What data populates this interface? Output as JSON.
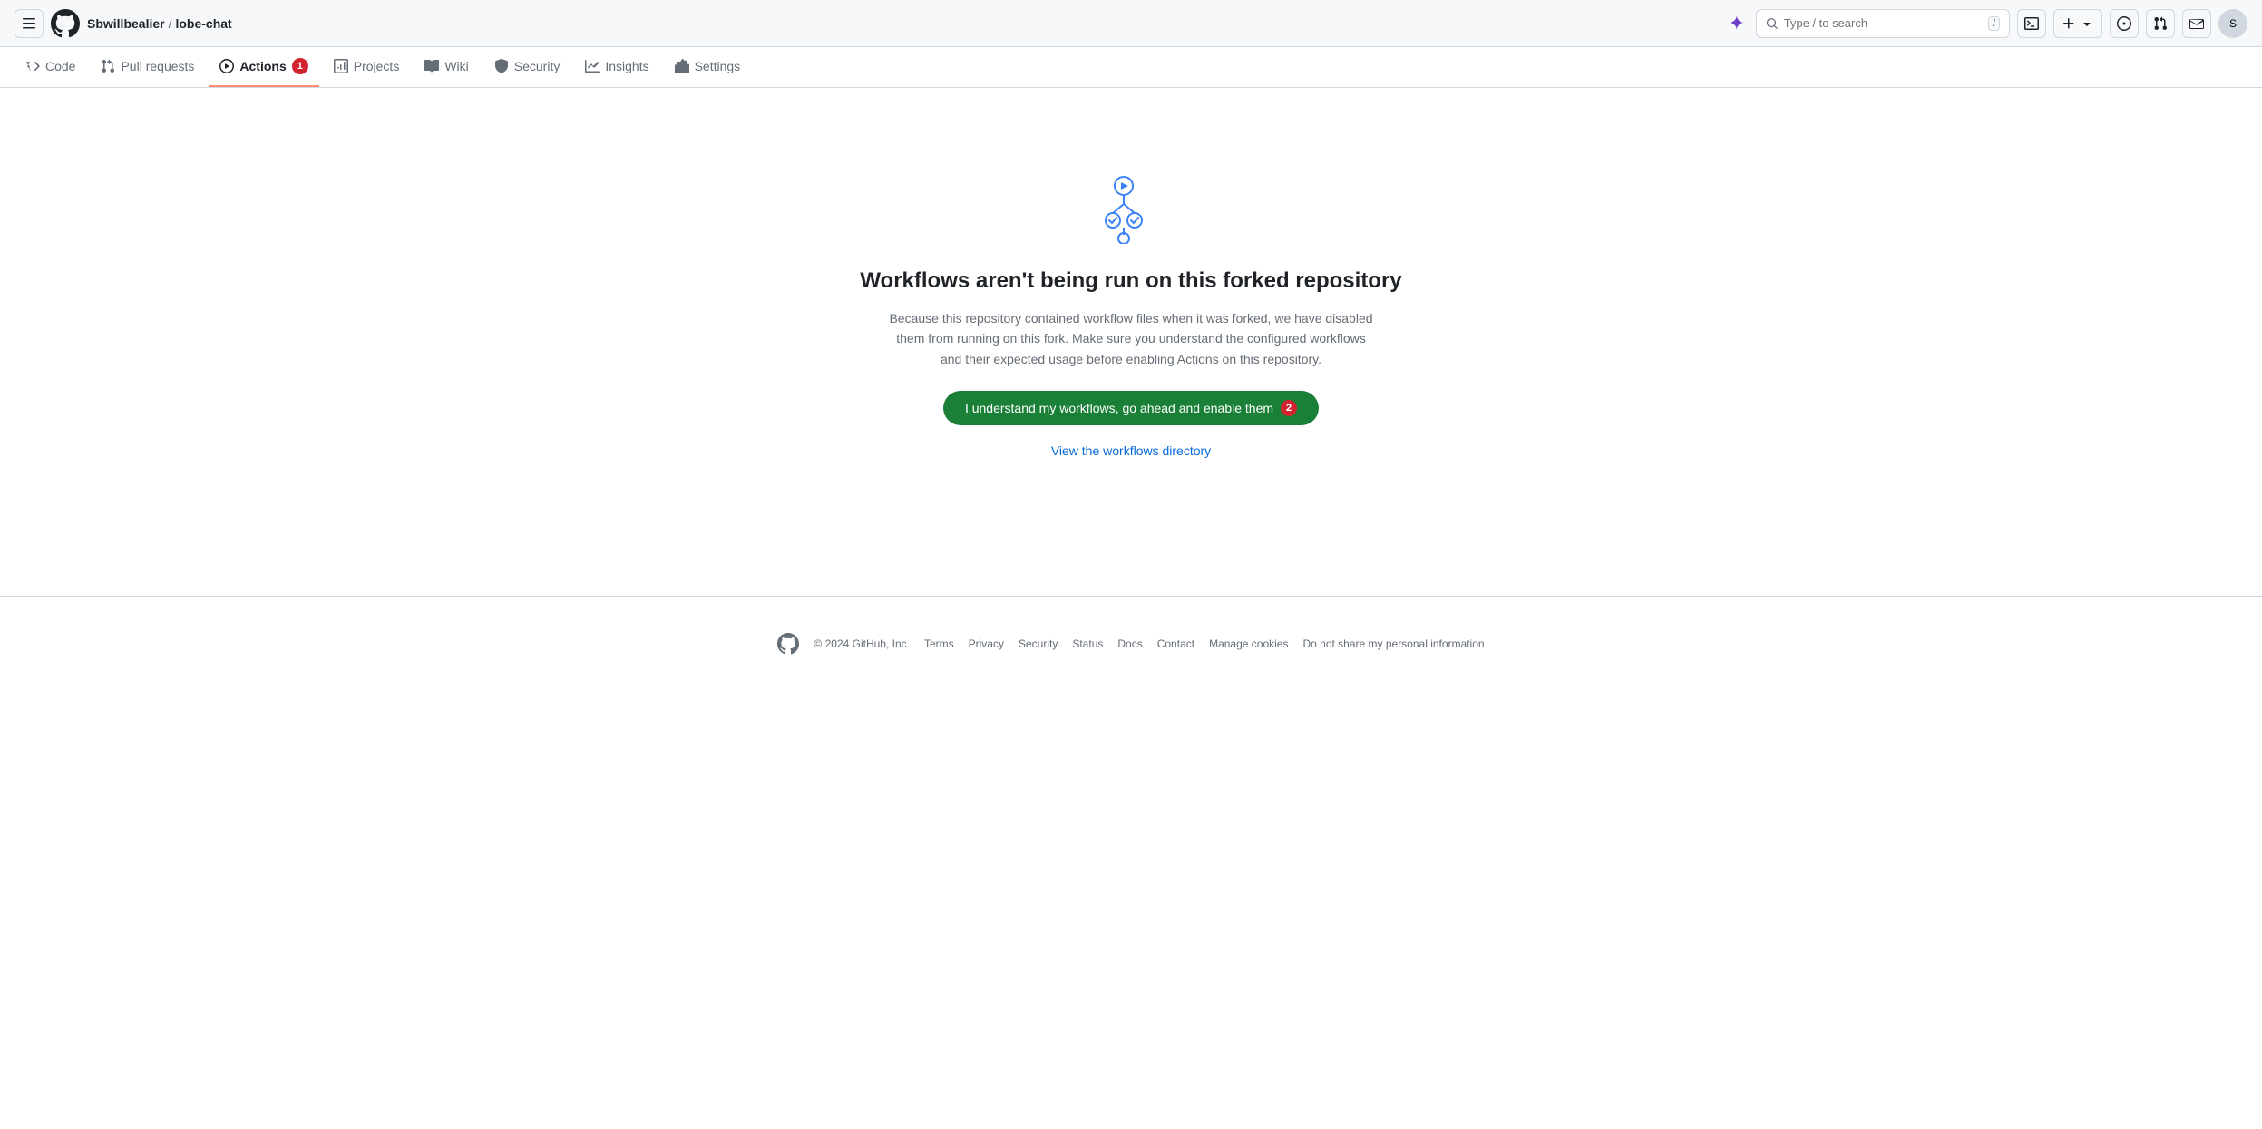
{
  "topNav": {
    "hamburger_label": "☰",
    "breadcrumb": {
      "user": "Sbwillbealier",
      "separator": "/",
      "repo": "lobe-chat"
    },
    "search": {
      "placeholder": "Type / to search",
      "shortcut": "/"
    },
    "copilot_icon": "✦",
    "new_icon": "+",
    "new_dropdown": "▾",
    "terminal_icon": "⌨",
    "pullrequest_icon": "⇄",
    "inbox_icon": "✉",
    "avatar_text": "S"
  },
  "repoNav": {
    "items": [
      {
        "id": "code",
        "label": "Code",
        "icon": "<>",
        "active": false
      },
      {
        "id": "pull-requests",
        "label": "Pull requests",
        "icon": "⇄",
        "active": false
      },
      {
        "id": "actions",
        "label": "Actions",
        "icon": "▶",
        "active": true,
        "badge": "1"
      },
      {
        "id": "projects",
        "label": "Projects",
        "icon": "⊞",
        "active": false
      },
      {
        "id": "wiki",
        "label": "Wiki",
        "icon": "📖",
        "active": false
      },
      {
        "id": "security",
        "label": "Security",
        "icon": "🛡",
        "active": false
      },
      {
        "id": "insights",
        "label": "Insights",
        "icon": "📈",
        "active": false
      },
      {
        "id": "settings",
        "label": "Settings",
        "icon": "⚙",
        "active": false
      }
    ]
  },
  "mainContent": {
    "title": "Workflows aren't being run on this forked repository",
    "description": "Because this repository contained workflow files when it was forked, we have disabled them from running on this fork. Make sure you understand the configured workflows and their expected usage before enabling Actions on this repository.",
    "enable_button_label": "I understand my workflows, go ahead and enable them",
    "enable_button_badge": "2",
    "view_workflows_label": "View the workflows directory"
  },
  "footer": {
    "copyright": "© 2024 GitHub, Inc.",
    "links": [
      {
        "label": "Terms"
      },
      {
        "label": "Privacy"
      },
      {
        "label": "Security"
      },
      {
        "label": "Status"
      },
      {
        "label": "Docs"
      },
      {
        "label": "Contact"
      },
      {
        "label": "Manage cookies"
      },
      {
        "label": "Do not share my personal information"
      }
    ]
  }
}
